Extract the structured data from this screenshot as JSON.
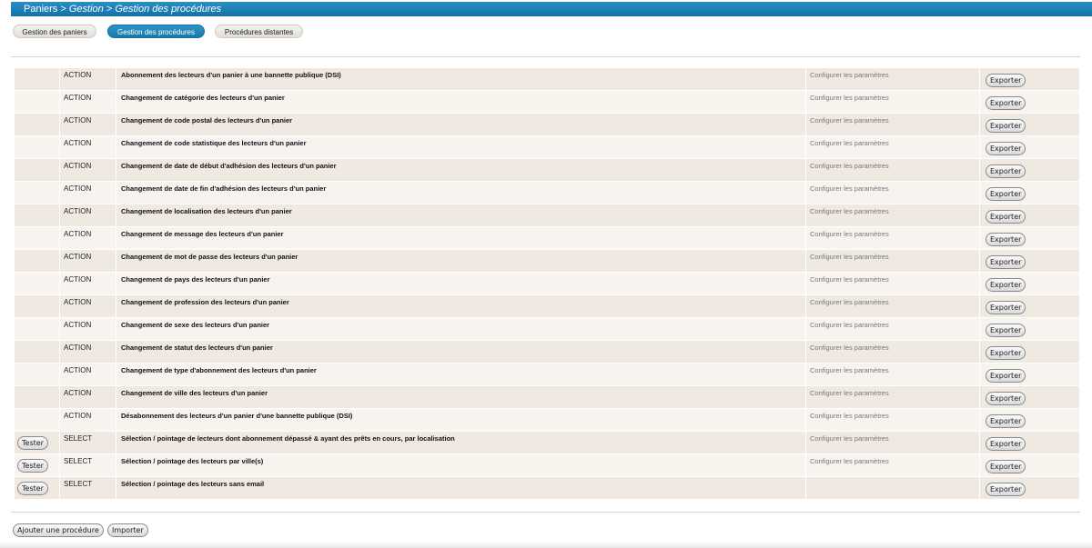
{
  "breadcrumb": {
    "root": "Paniers",
    "sep": " > ",
    "level1": "Gestion",
    "level2": "Gestion des procédures"
  },
  "tabs": [
    {
      "label": "Gestion des paniers",
      "active": false
    },
    {
      "label": "Gestion des procédures",
      "active": true
    },
    {
      "label": "Procédures distantes",
      "active": false
    }
  ],
  "rows": [
    {
      "test_label": "",
      "type": "ACTION",
      "label": "Abonnement des lecteurs d'un panier à une bannette publique (DSI)",
      "config": "Configurer les paramètres",
      "export_label": "Exporter"
    },
    {
      "test_label": "",
      "type": "ACTION",
      "label": "Changement de catégorie des lecteurs d'un panier",
      "config": "Configurer les paramètres",
      "export_label": "Exporter"
    },
    {
      "test_label": "",
      "type": "ACTION",
      "label": "Changement de code postal des lecteurs d'un panier",
      "config": "Configurer les paramètres",
      "export_label": "Exporter"
    },
    {
      "test_label": "",
      "type": "ACTION",
      "label": "Changement de code statistique des lecteurs d'un panier",
      "config": "Configurer les paramètres",
      "export_label": "Exporter"
    },
    {
      "test_label": "",
      "type": "ACTION",
      "label": "Changement de date de début d'adhésion des lecteurs d'un panier",
      "config": "Configurer les paramètres",
      "export_label": "Exporter"
    },
    {
      "test_label": "",
      "type": "ACTION",
      "label": "Changement de date de fin d'adhésion des lecteurs d'un panier",
      "config": "Configurer les paramètres",
      "export_label": "Exporter"
    },
    {
      "test_label": "",
      "type": "ACTION",
      "label": "Changement de localisation des lecteurs d'un panier",
      "config": "Configurer les paramètres",
      "export_label": "Exporter"
    },
    {
      "test_label": "",
      "type": "ACTION",
      "label": "Changement de message des lecteurs d'un panier",
      "config": "Configurer les paramètres",
      "export_label": "Exporter"
    },
    {
      "test_label": "",
      "type": "ACTION",
      "label": "Changement de mot de passe des lecteurs d'un panier",
      "config": "Configurer les paramètres",
      "export_label": "Exporter"
    },
    {
      "test_label": "",
      "type": "ACTION",
      "label": "Changement de pays des lecteurs d'un panier",
      "config": "Configurer les paramètres",
      "export_label": "Exporter"
    },
    {
      "test_label": "",
      "type": "ACTION",
      "label": "Changement de profession des lecteurs d'un panier",
      "config": "Configurer les paramètres",
      "export_label": "Exporter"
    },
    {
      "test_label": "",
      "type": "ACTION",
      "label": "Changement de sexe des lecteurs d'un panier",
      "config": "Configurer les paramètres",
      "export_label": "Exporter"
    },
    {
      "test_label": "",
      "type": "ACTION",
      "label": "Changement de statut des lecteurs d'un panier",
      "config": "Configurer les paramètres",
      "export_label": "Exporter"
    },
    {
      "test_label": "",
      "type": "ACTION",
      "label": "Changement de type d'abonnement des lecteurs d'un panier",
      "config": "Configurer les paramètres",
      "export_label": "Exporter"
    },
    {
      "test_label": "",
      "type": "ACTION",
      "label": "Changement de ville des lecteurs d'un panier",
      "config": "Configurer les paramètres",
      "export_label": "Exporter"
    },
    {
      "test_label": "",
      "type": "ACTION",
      "label": "Désabonnement des lecteurs d'un panier d'une bannette publique (DSI)",
      "config": "Configurer les paramètres",
      "export_label": "Exporter"
    },
    {
      "test_label": "Tester",
      "type": "SELECT",
      "label": "Sélection / pointage de lecteurs dont abonnement dépassé & ayant des prêts en cours, par localisation",
      "config": "Configurer les paramètres",
      "export_label": "Exporter"
    },
    {
      "test_label": "Tester",
      "type": "SELECT",
      "label": "Sélection / pointage des lecteurs par ville(s)",
      "config": "Configurer les paramètres",
      "export_label": "Exporter"
    },
    {
      "test_label": "Tester",
      "type": "SELECT",
      "label": "Sélection / pointage des lecteurs sans email",
      "config": "",
      "export_label": "Exporter"
    }
  ],
  "actions": {
    "add_label": "Ajouter une procédure",
    "import_label": "Importer"
  },
  "colors": {
    "header_blue": "#1a7db5",
    "row_odd": "#efe9e2",
    "row_even": "#f7f4f0",
    "config_text": "#777777"
  }
}
